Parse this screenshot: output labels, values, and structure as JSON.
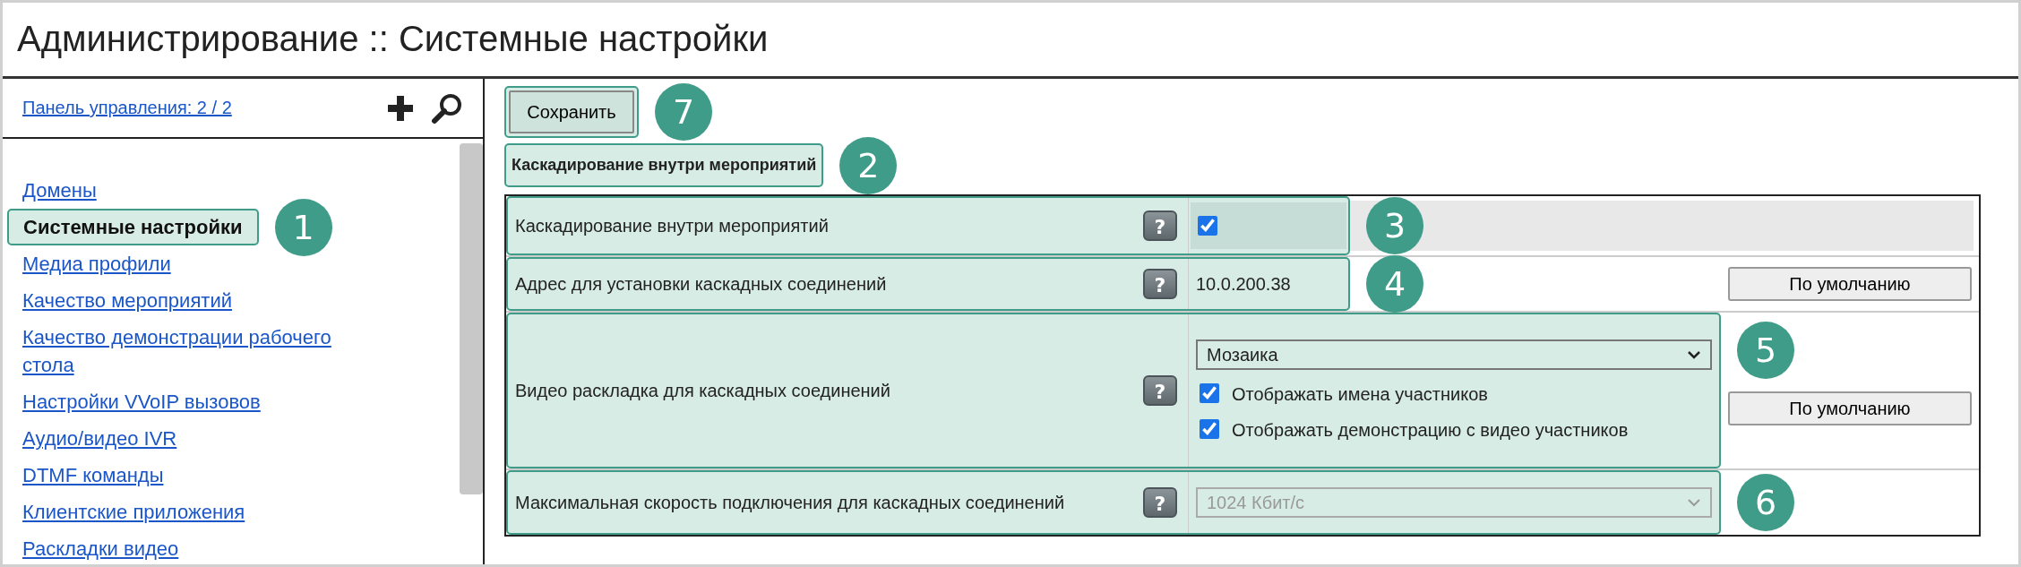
{
  "title": "Администрирование :: Системные настройки",
  "sidebar": {
    "panel_link": "Панель управления: 2 / 2",
    "items": [
      {
        "label": "Домены",
        "selected": false
      },
      {
        "label": "Системные настройки",
        "selected": true,
        "highlighted": true,
        "callout": "1"
      },
      {
        "label": "Медиа профили",
        "selected": false
      },
      {
        "label": "Качество мероприятий",
        "selected": false
      },
      {
        "label": "Качество демонстрации рабочего стола",
        "selected": false
      },
      {
        "label": "Настройки VVoIP вызовов",
        "selected": false
      },
      {
        "label": "Аудио/видео IVR",
        "selected": false
      },
      {
        "label": "DTMF команды",
        "selected": false
      },
      {
        "label": "Клиентские приложения",
        "selected": false
      },
      {
        "label": "Раскладки видео",
        "selected": false
      }
    ]
  },
  "save_button": {
    "label": "Сохранить",
    "highlighted": true,
    "callout": "7"
  },
  "section": {
    "title": "Каскадирование внутри мероприятий",
    "highlighted": true,
    "callout": "2"
  },
  "settings": [
    {
      "kind": "checkbox",
      "label": "Каскадирование внутри мероприятий",
      "help": "?",
      "checked": true,
      "highlighted": true,
      "callout": "3"
    },
    {
      "kind": "text",
      "label": "Адрес для установки каскадных соединений",
      "help": "?",
      "value": "10.0.200.38",
      "default_button": "По умолчанию",
      "highlighted": true,
      "callout": "4"
    },
    {
      "kind": "layout",
      "label": "Видео раскладка для каскадных соединений",
      "help": "?",
      "value": "Мозаика",
      "options": [
        {
          "label": "Отображать имена участников",
          "checked": true
        },
        {
          "label": "Отображать демонстрацию с видео участников",
          "checked": true
        }
      ],
      "default_button": "По умолчанию",
      "highlighted": true,
      "callout": "5"
    },
    {
      "kind": "select",
      "label": "Максимальная скорость подключения для каскадных соединений",
      "help": "?",
      "value": "1024 Кбит/с",
      "disabled": true,
      "highlighted": true,
      "callout": "6"
    }
  ]
}
